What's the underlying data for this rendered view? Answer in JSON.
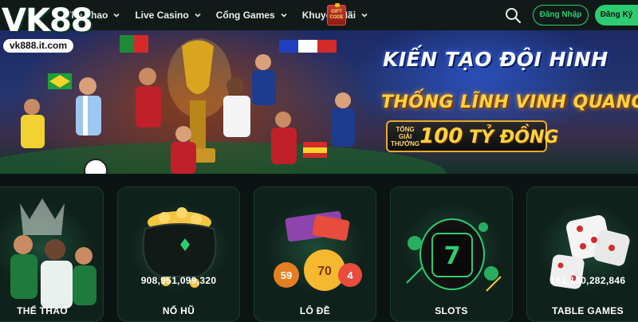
{
  "brand": {
    "logo_text": "VK88",
    "url": "vk888.it.com"
  },
  "header": {
    "nav": [
      {
        "label": "Thể Thao",
        "icon": "chevron-down-icon"
      },
      {
        "label": "Live Casino",
        "icon": "chevron-down-icon"
      },
      {
        "label": "Cổng Games",
        "icon": "chevron-down-icon"
      },
      {
        "label": "Khuyến Mãi",
        "icon": "chevron-down-icon"
      }
    ],
    "gift_code": "GIFT CODE",
    "login_label": "Đăng Nhập",
    "register_label": "Đăng Ký"
  },
  "banner": {
    "headline_1": "KIẾN TẠO ĐỘI HÌNH",
    "headline_2": "THỐNG LĨNH VINH QUANG",
    "prize_label": "TỔNG GIẢI THƯỞNG",
    "prize_number": "100",
    "prize_unit": "TỶ ĐỒNG"
  },
  "cards": [
    {
      "label": "THỂ THAO",
      "jackpot": "",
      "icon": "football-players-icon"
    },
    {
      "label": "NỔ HŨ",
      "jackpot": "908,951,099,320",
      "icon": "gold-pot-icon"
    },
    {
      "label": "LÔ ĐỀ",
      "jackpot": "",
      "icon": "lottery-balls-icon"
    },
    {
      "label": "SLOTS",
      "jackpot": "",
      "icon": "slot-reels-icon"
    },
    {
      "label": "TABLE GAMES",
      "jackpot": "161,180,282,846",
      "icon": "dice-icon"
    }
  ],
  "colors": {
    "accent": "#2ecc71",
    "background": "#0b1412",
    "gold": "#ffd23f"
  }
}
